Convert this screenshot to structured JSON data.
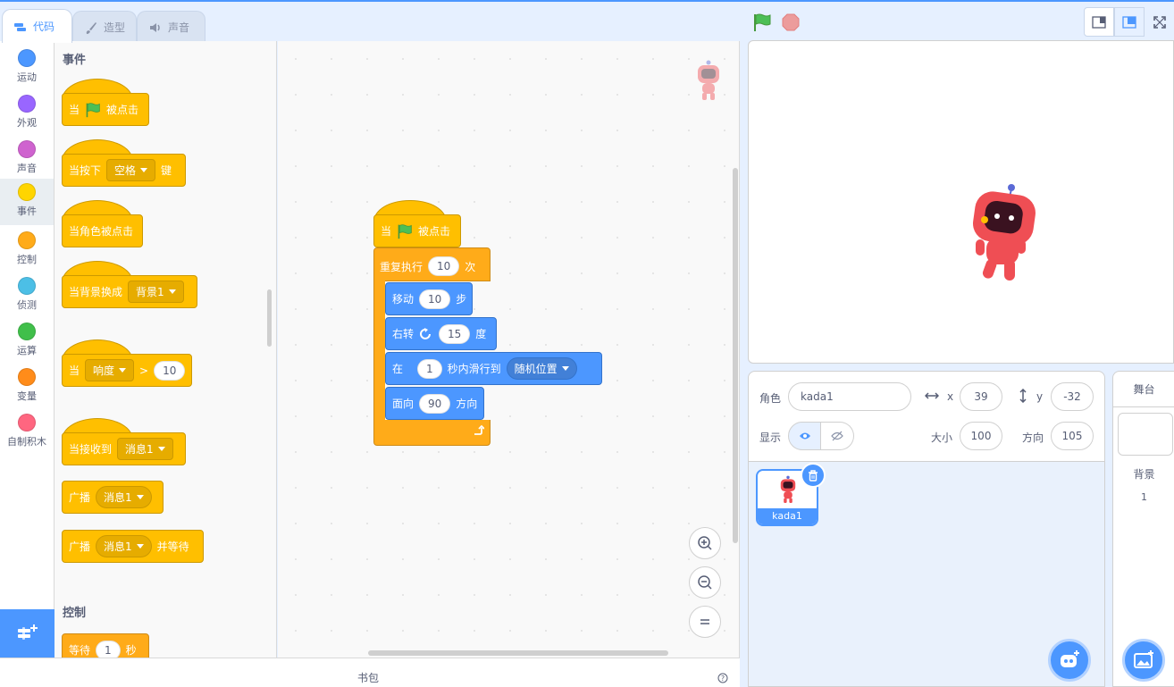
{
  "tabs": {
    "code": "代码",
    "costumes": "造型",
    "sounds": "声音"
  },
  "categories": [
    {
      "label": "运动",
      "color": "#4c97ff"
    },
    {
      "label": "外观",
      "color": "#9966ff"
    },
    {
      "label": "声音",
      "color": "#cf63cf"
    },
    {
      "label": "事件",
      "color": "#ffd500"
    },
    {
      "label": "控制",
      "color": "#ffab19"
    },
    {
      "label": "侦测",
      "color": "#4cbfe6"
    },
    {
      "label": "运算",
      "color": "#40bf4a"
    },
    {
      "label": "变量",
      "color": "#ff8c1a"
    },
    {
      "label": "自制积木",
      "color": "#ff6680"
    }
  ],
  "palette": {
    "events_title": "事件",
    "control_title": "控制",
    "when_flag": {
      "prefix": "当",
      "suffix": "被点击"
    },
    "when_key": {
      "prefix": "当按下",
      "key": "空格",
      "suffix": "键"
    },
    "when_sprite_clicked": "当角色被点击",
    "when_backdrop": {
      "prefix": "当背景换成",
      "value": "背景1"
    },
    "when_greater": {
      "prefix": "当",
      "sensor": "响度",
      "op": ">",
      "value": "10"
    },
    "when_receive": {
      "prefix": "当接收到",
      "value": "消息1"
    },
    "broadcast": {
      "prefix": "广播",
      "value": "消息1"
    },
    "broadcast_wait": {
      "prefix": "广播",
      "value": "消息1",
      "suffix": "并等待"
    },
    "wait": {
      "prefix": "等待",
      "value": "1",
      "suffix": "秒"
    }
  },
  "script": {
    "hat": {
      "prefix": "当",
      "suffix": "被点击"
    },
    "repeat": {
      "prefix": "重复执行",
      "value": "10",
      "suffix": "次"
    },
    "move": {
      "prefix": "移动",
      "value": "10",
      "suffix": "步"
    },
    "turn": {
      "prefix": "右转",
      "value": "15",
      "suffix": "度"
    },
    "glide": {
      "prefix": "在",
      "value": "1",
      "middle": "秒内滑行到",
      "target": "随机位置"
    },
    "point": {
      "prefix": "面向",
      "value": "90",
      "suffix": "方向"
    }
  },
  "backpack": {
    "label": "书包"
  },
  "sprite_info": {
    "sprite_label": "角色",
    "sprite_name": "kada1",
    "x_label": "x",
    "x_value": "39",
    "y_label": "y",
    "y_value": "-32",
    "show_label": "显示",
    "size_label": "大小",
    "size_value": "100",
    "direction_label": "方向",
    "direction_value": "105"
  },
  "sprites": [
    {
      "name": "kada1"
    }
  ],
  "stage_panel": {
    "title": "舞台",
    "backdrops_label": "背景",
    "backdrops_count": "1"
  },
  "colors": {
    "accent": "#4c97ff",
    "events": "#ffbf00",
    "motion": "#4c97ff",
    "control": "#ffab19",
    "robot": "#ef4e54"
  }
}
